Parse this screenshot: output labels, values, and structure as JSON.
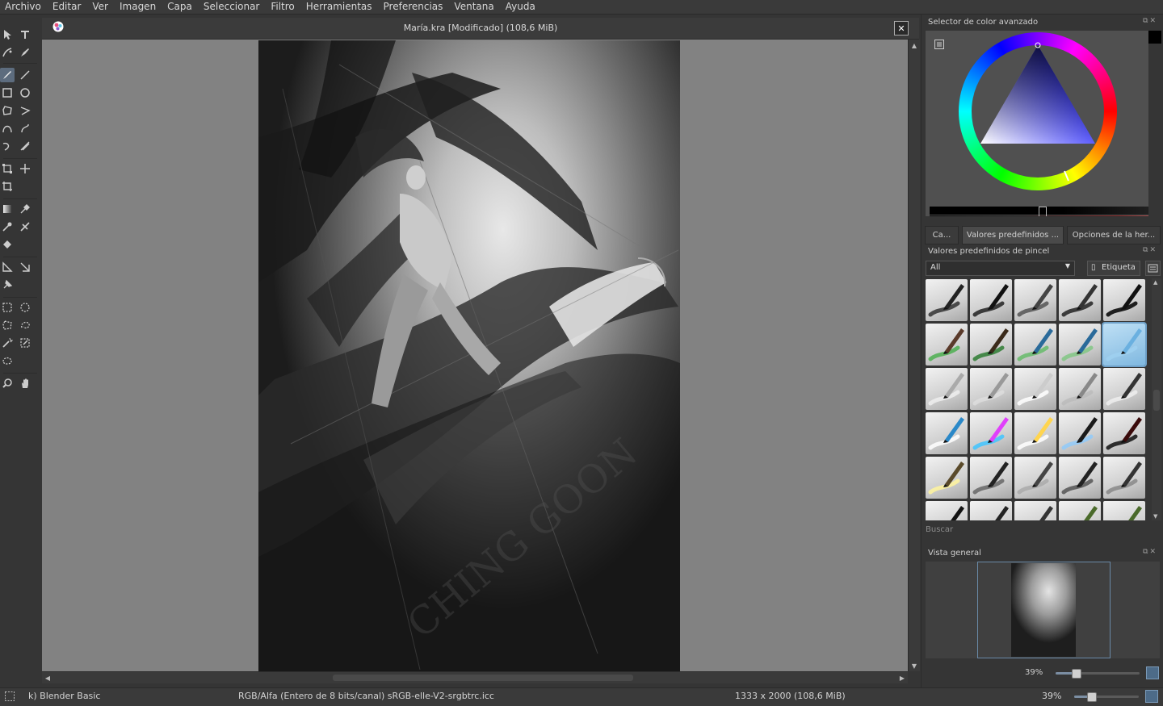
{
  "menu": [
    "Archivo",
    "Editar",
    "Ver",
    "Imagen",
    "Capa",
    "Seleccionar",
    "Filtro",
    "Herramientas",
    "Preferencias",
    "Ventana",
    "Ayuda"
  ],
  "document": {
    "title": "María.kra [Modificado]  (108,6 MiB)"
  },
  "dockers": {
    "color_selector": {
      "title": "Selector de color avanzado"
    },
    "tabs": [
      "Ca...",
      "Valores predefinidos ...",
      "Opciones de la her..."
    ],
    "brush_presets": {
      "title": "Valores predefinidos de pincel",
      "filter_value": "All",
      "tag_label": "Etiqueta",
      "search_placeholder": "Buscar"
    },
    "overview": {
      "title": "Vista general",
      "zoom": "39%"
    }
  },
  "status": {
    "brush": "k) Blender Basic",
    "color_info": "RGB/Alfa (Entero de 8 bits/canal)  sRGB-elle-V2-srgbtrc.icc",
    "dimensions": "1333 x 2000 (108,6 MiB)",
    "zoom": "39%"
  },
  "colors": {
    "accent": "#6ea0c8",
    "panel": "#353535",
    "canvas_bg": "#828282"
  },
  "icons": {
    "tools": [
      "select-shapes-icon",
      "text-icon",
      "calligraphy-icon",
      "path-edit-icon",
      "freehand-brush-icon",
      "line-icon",
      "rectangle-icon",
      "ellipse-icon",
      "polygon-icon",
      "polyline-icon",
      "bezier-icon",
      "freehand-path-icon",
      "dynamic-brush-icon",
      "multibrush-icon",
      "transform-icon",
      "move-icon",
      "crop-icon",
      "gradient-icon",
      "color-picker-icon",
      "colorize-mask-icon",
      "smart-patch-icon",
      "fill-icon",
      "assistant-icon",
      "measure-icon",
      "reference-icon",
      "rect-select-icon",
      "ellipse-select-icon",
      "polygon-select-icon",
      "freehand-select-icon",
      "magic-wand-icon",
      "similar-select-icon",
      "bezier-select-icon",
      "zoom-icon",
      "pan-icon"
    ]
  }
}
